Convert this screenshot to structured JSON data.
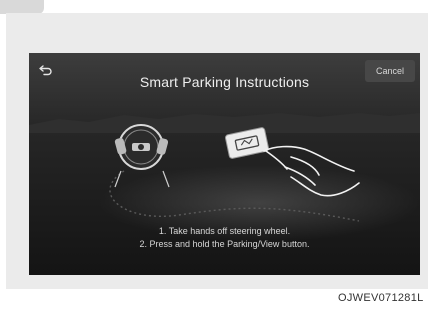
{
  "screen": {
    "title": "Smart Parking Instructions",
    "cancel_label": "Cancel",
    "instructions": [
      "1. Take hands off steering wheel.",
      "2. Press and hold the Parking/View button."
    ]
  },
  "icons": {
    "back": "back-arrow-icon",
    "steering": "steering-wheel-icon",
    "hand": "pointing-hand-icon",
    "button": "parking-view-button-icon"
  },
  "colors": {
    "screen_bg": "#262626",
    "text": "#efefef",
    "cancel_bg": "#474747"
  },
  "figure_code": "OJWEV071281L"
}
